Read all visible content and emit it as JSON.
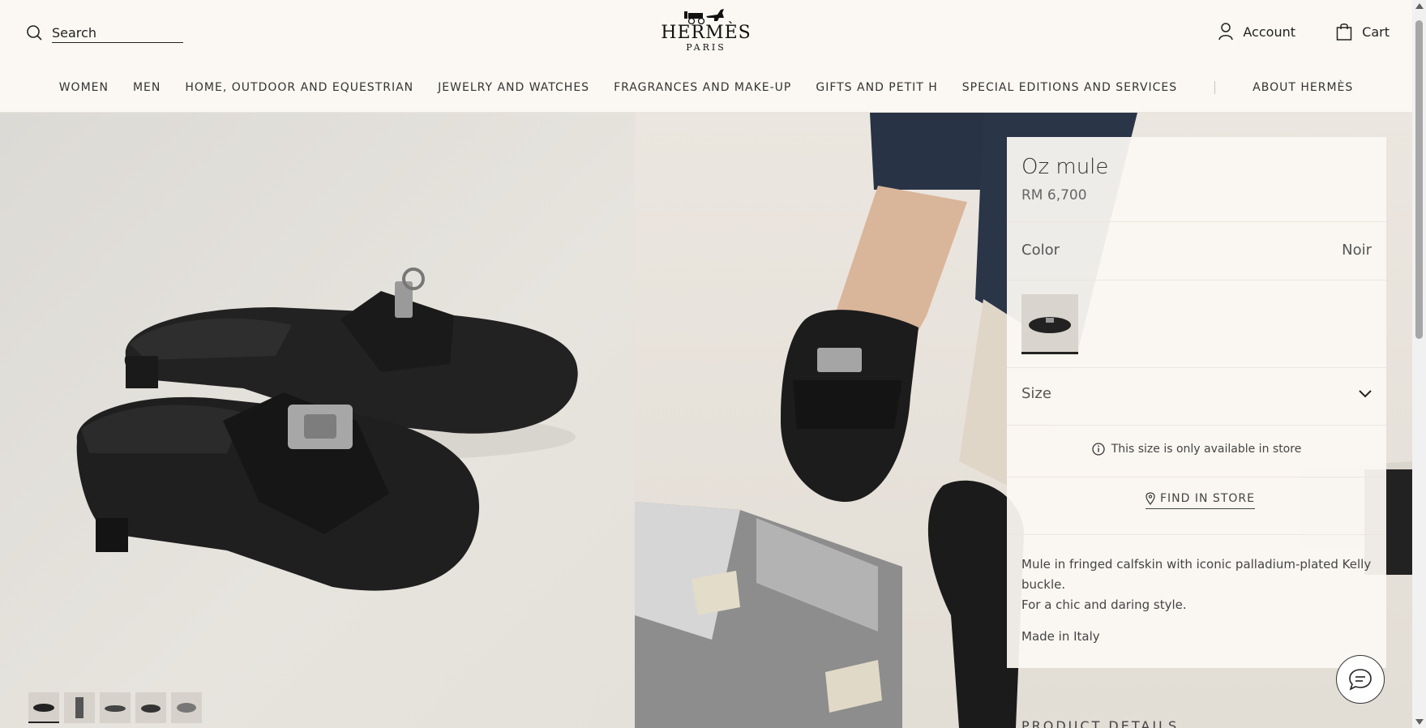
{
  "header": {
    "search_label": "Search",
    "brand": "HERMÈS",
    "brand_sub": "PARIS",
    "account_label": "Account",
    "cart_label": "Cart"
  },
  "nav": [
    "WOMEN",
    "MEN",
    "HOME, OUTDOOR AND EQUESTRIAN",
    "JEWELRY AND WATCHES",
    "FRAGRANCES AND MAKE-UP",
    "GIFTS AND PETIT H",
    "SPECIAL EDITIONS AND SERVICES",
    "ABOUT HERMÈS"
  ],
  "product": {
    "title": "Oz mule",
    "price": "RM 6,700",
    "color_label": "Color",
    "color_value": "Noir",
    "size_label": "Size",
    "availability_note": "This size is only available in store",
    "find_store_label": "FIND IN STORE",
    "description_line1": "Mule in fringed calfskin with iconic palladium-plated Kelly buckle.",
    "description_line2": "For a chic and daring style.",
    "made_in": "Made in Italy",
    "details_heading": "PRODUCT DETAILS"
  },
  "gallery": {
    "thumb_count": 5,
    "active_thumb": 1
  },
  "icons": {
    "search": "search-icon",
    "account": "user-icon",
    "cart": "shopping-bag-icon",
    "chevron": "chevron-down-icon",
    "info": "info-icon",
    "location": "location-pin-icon",
    "chat": "chat-icon"
  }
}
